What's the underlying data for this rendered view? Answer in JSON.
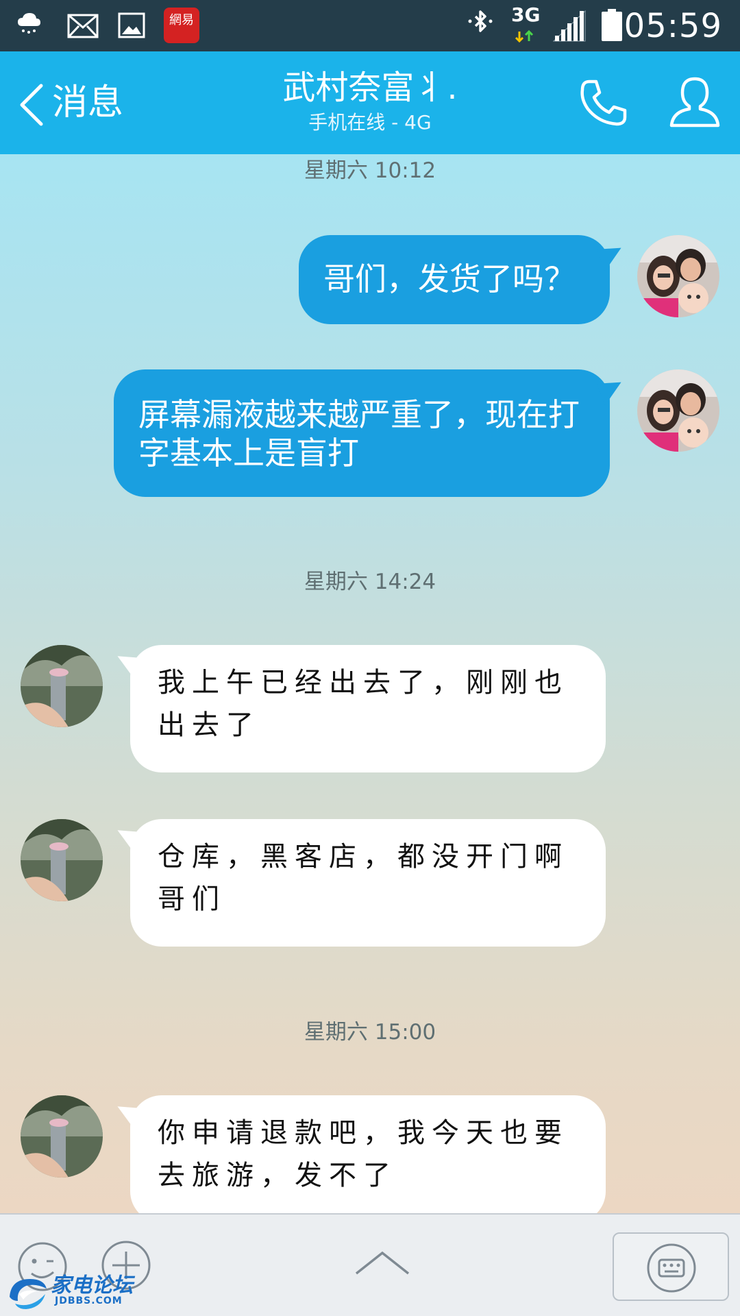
{
  "status_bar": {
    "time": "05:59",
    "network": "3G",
    "icons": [
      "cloud-weather-icon",
      "mail-icon",
      "image-icon",
      "netease-app-icon",
      "bluetooth-icon",
      "network-3g-icon",
      "signal-icon",
      "battery-icon"
    ],
    "netease_label": "網易"
  },
  "header": {
    "back_label": "消息",
    "contact_name": "武村奈富丬.",
    "contact_status": "手机在线 - 4G",
    "background_color": "#1bb3ea"
  },
  "messages": [
    {
      "kind": "timestamp",
      "text": "星期六 10:12"
    },
    {
      "kind": "outgoing",
      "text": "哥们，发货了吗？"
    },
    {
      "kind": "outgoing",
      "text": "屏幕漏液越来越严重了，现在打字基本上是盲打"
    },
    {
      "kind": "timestamp",
      "text": "星期六 14:24"
    },
    {
      "kind": "incoming",
      "text": "我上午已经出去了，刚刚也出去了"
    },
    {
      "kind": "incoming",
      "text": "仓库，黑客店，都没开门啊哥们"
    },
    {
      "kind": "timestamp",
      "text": "星期六 15:00"
    },
    {
      "kind": "incoming",
      "text": "你申请退款吧，我今天也要去旅游，发不了"
    }
  ],
  "colors": {
    "outgoing_bubble": "#1a9fe0",
    "incoming_bubble": "#ffffff",
    "status_bar": "#243d4a"
  },
  "watermark": {
    "text": "家电论坛",
    "sub": "JDBBS.COM"
  }
}
